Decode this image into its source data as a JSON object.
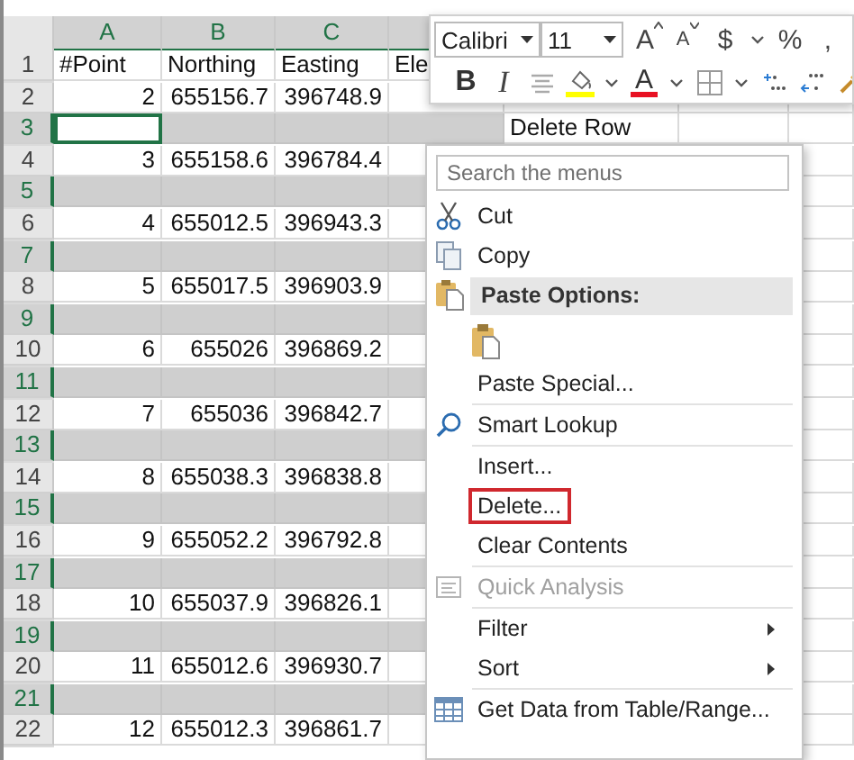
{
  "sheet": {
    "columns": [
      {
        "label": "A",
        "selected": true
      },
      {
        "label": "B",
        "selected": true
      },
      {
        "label": "C",
        "selected": true
      },
      {
        "selected": true
      }
    ],
    "rows": [
      {
        "number": "1",
        "kind": "text",
        "selected": false,
        "active_cell": false,
        "cells": {
          "A": "#Point",
          "B": "Northing",
          "C": "Easting",
          "D": "Ele"
        }
      },
      {
        "number": "2",
        "kind": "number",
        "selected": false,
        "active_cell": false,
        "cells": {
          "A": "2",
          "B": "655156.7",
          "C": "396748.9"
        }
      },
      {
        "number": "3",
        "kind": "text",
        "selected": true,
        "active_cell": true,
        "cells": {
          "E": "Delete Row"
        }
      },
      {
        "number": "4",
        "kind": "number",
        "selected": false,
        "active_cell": false,
        "cells": {
          "A": "3",
          "B": "655158.6",
          "C": "396784.4"
        }
      },
      {
        "number": "5",
        "kind": "number",
        "selected": true,
        "active_cell": false,
        "cells": {}
      },
      {
        "number": "6",
        "kind": "number",
        "selected": false,
        "active_cell": false,
        "cells": {
          "A": "4",
          "B": "655012.5",
          "C": "396943.3"
        }
      },
      {
        "number": "7",
        "kind": "number",
        "selected": true,
        "active_cell": false,
        "cells": {}
      },
      {
        "number": "8",
        "kind": "number",
        "selected": false,
        "active_cell": false,
        "cells": {
          "A": "5",
          "B": "655017.5",
          "C": "396903.9"
        }
      },
      {
        "number": "9",
        "kind": "number",
        "selected": true,
        "active_cell": false,
        "cells": {}
      },
      {
        "number": "10",
        "kind": "number",
        "selected": false,
        "active_cell": false,
        "cells": {
          "A": "6",
          "B": "655026",
          "C": "396869.2"
        }
      },
      {
        "number": "11",
        "kind": "number",
        "selected": true,
        "active_cell": false,
        "cells": {}
      },
      {
        "number": "12",
        "kind": "number",
        "selected": false,
        "active_cell": false,
        "cells": {
          "A": "7",
          "B": "655036",
          "C": "396842.7"
        }
      },
      {
        "number": "13",
        "kind": "number",
        "selected": true,
        "active_cell": false,
        "cells": {}
      },
      {
        "number": "14",
        "kind": "number",
        "selected": false,
        "active_cell": false,
        "cells": {
          "A": "8",
          "B": "655038.3",
          "C": "396838.8"
        }
      },
      {
        "number": "15",
        "kind": "number",
        "selected": true,
        "active_cell": false,
        "cells": {}
      },
      {
        "number": "16",
        "kind": "number",
        "selected": false,
        "active_cell": false,
        "cells": {
          "A": "9",
          "B": "655052.2",
          "C": "396792.8"
        }
      },
      {
        "number": "17",
        "kind": "number",
        "selected": true,
        "active_cell": false,
        "cells": {}
      },
      {
        "number": "18",
        "kind": "number",
        "selected": false,
        "active_cell": false,
        "cells": {
          "A": "10",
          "B": "655037.9",
          "C": "396826.1"
        }
      },
      {
        "number": "19",
        "kind": "number",
        "selected": true,
        "active_cell": false,
        "cells": {}
      },
      {
        "number": "20",
        "kind": "number",
        "selected": false,
        "active_cell": false,
        "cells": {
          "A": "11",
          "B": "655012.6",
          "C": "396930.7"
        }
      },
      {
        "number": "21",
        "kind": "number",
        "selected": true,
        "active_cell": false,
        "cells": {}
      },
      {
        "number": "22",
        "kind": "number",
        "selected": false,
        "active_cell": false,
        "cells": {
          "A": "12",
          "B": "655012.3",
          "C": "396861.7"
        }
      }
    ]
  },
  "mini_toolbar": {
    "font": "Calibri",
    "size": "11",
    "row_1": [
      {
        "kind": "grow",
        "label": "A"
      },
      {
        "kind": "shrink",
        "label": "A"
      },
      {
        "kind": "text",
        "label": "$"
      },
      {
        "kind": "chevron"
      },
      {
        "kind": "text",
        "label": "%"
      },
      {
        "kind": "text",
        "label": ","
      }
    ],
    "row_2": [
      {
        "kind": "bold",
        "label": "B"
      },
      {
        "kind": "italic",
        "label": "I"
      },
      {
        "kind": "align"
      },
      {
        "kind": "fill",
        "color": "#ffff00"
      },
      {
        "kind": "chevron"
      },
      {
        "kind": "font_color",
        "label": "A",
        "color": "#e81123"
      },
      {
        "kind": "chevron"
      },
      {
        "kind": "borders"
      },
      {
        "kind": "chevron"
      },
      {
        "kind": "increase_decimal"
      },
      {
        "kind": "decrease_decimal"
      },
      {
        "kind": "painter"
      }
    ]
  },
  "context_menu": {
    "search": {
      "placeholder": "Search the menus"
    },
    "items": [
      {
        "kind": "command",
        "label": "Cut",
        "divider_above": false,
        "highlighted": false,
        "disabled": false
      },
      {
        "kind": "command",
        "label": "Copy",
        "divider_above": false,
        "highlighted": false,
        "disabled": false
      },
      {
        "kind": "header",
        "label": "Paste Options:"
      },
      {
        "kind": "paste"
      },
      {
        "kind": "command",
        "label": "Paste Special...",
        "divider_above": false,
        "highlighted": false,
        "disabled": false
      },
      {
        "kind": "command",
        "label": "Smart Lookup",
        "divider_above": true,
        "highlighted": false,
        "disabled": false
      },
      {
        "kind": "command",
        "label": "Insert...",
        "divider_above": true,
        "highlighted": false,
        "disabled": false
      },
      {
        "kind": "command",
        "label": "Delete...",
        "divider_above": false,
        "highlighted": true,
        "disabled": false
      },
      {
        "kind": "command",
        "label": "Clear Contents",
        "divider_above": false,
        "highlighted": false,
        "disabled": false
      },
      {
        "kind": "command",
        "label": "Quick Analysis",
        "divider_above": true,
        "highlighted": false,
        "disabled": true
      },
      {
        "kind": "submenu",
        "label": "Filter",
        "divider_above": true,
        "highlighted": false,
        "disabled": false
      },
      {
        "kind": "submenu",
        "label": "Sort",
        "divider_above": false,
        "highlighted": false,
        "disabled": false
      },
      {
        "kind": "command",
        "label": "Get Data from Table/Range...",
        "divider_above": true,
        "highlighted": false,
        "disabled": false
      }
    ]
  }
}
